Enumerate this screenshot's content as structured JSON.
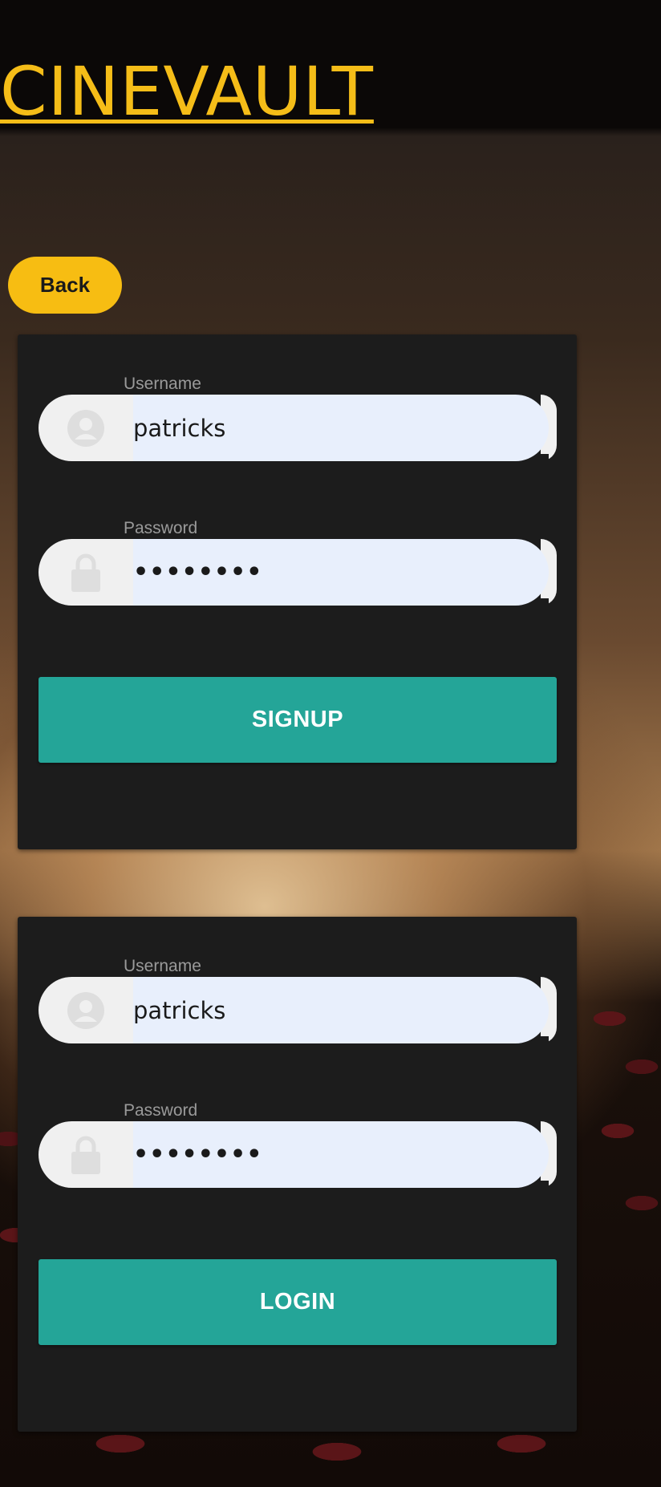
{
  "app": {
    "brand": "CINEVAULT",
    "accent_color": "#f5bd18"
  },
  "nav": {
    "back_label": "Back"
  },
  "signup_form": {
    "username_label": "Username",
    "username_value": "patricks",
    "password_label": "Password",
    "password_value": "••••••••",
    "submit_label": "SIGNUP",
    "username_icon": "user-icon",
    "password_icon": "lock-icon"
  },
  "login_form": {
    "username_label": "Username",
    "username_value": "patricks",
    "password_label": "Password",
    "password_value": "••••••••",
    "submit_label": "LOGIN",
    "username_icon": "user-icon",
    "password_icon": "lock-icon"
  },
  "colors": {
    "button": "#24a598",
    "card": "#1c1c1c",
    "input": "#e8effc"
  }
}
